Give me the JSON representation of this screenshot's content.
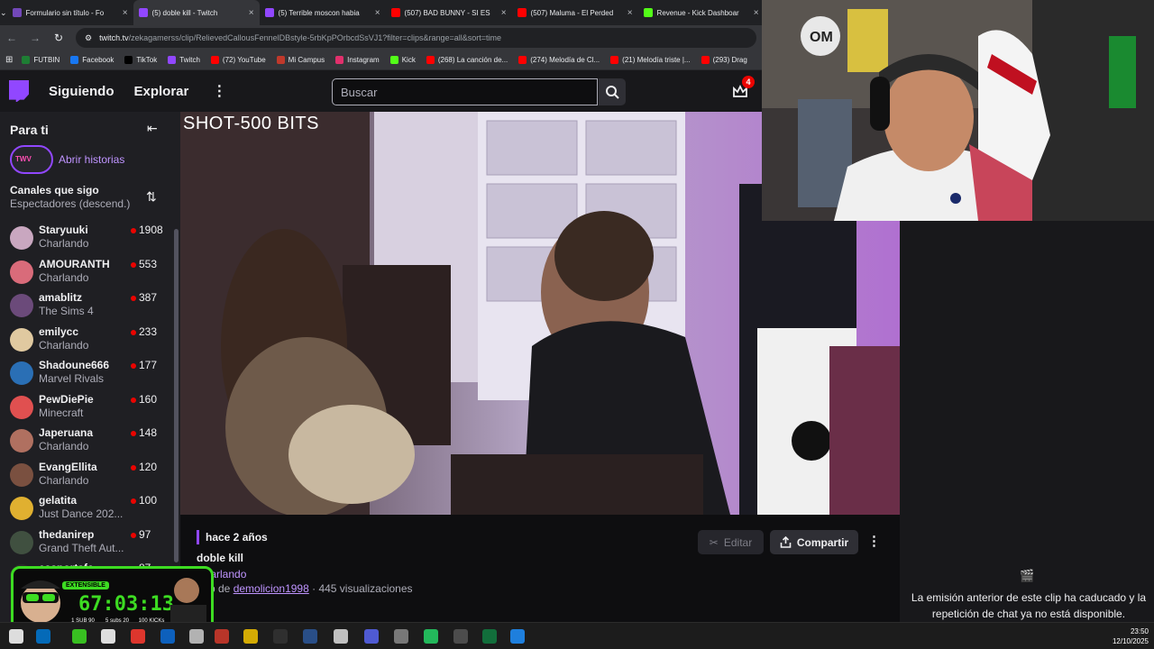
{
  "browser": {
    "tabs": [
      {
        "label": "Formulario sin título - Fo",
        "color": "#7248b9"
      },
      {
        "label": "(5) doble kill - Twitch",
        "color": "#9147ff",
        "active": true
      },
      {
        "label": "(5) Terrible moscon habia",
        "color": "#9147ff"
      },
      {
        "label": "(507) BAD BUNNY - SI ES",
        "color": "#ff0000"
      },
      {
        "label": "(507) Maluma - El Perded",
        "color": "#ff0000"
      },
      {
        "label": "Revenue - Kick Dashboar",
        "color": "#53fc18"
      }
    ],
    "url_host": "twitch.tv",
    "url_path": "/zekagamerss/clip/RelievedCallousFennelDBstyle-5rbKpPOrbcdSsVJ1?filter=clips&range=all&sort=time",
    "bookmarks": [
      {
        "label": "FUTBIN",
        "color": "#1e7e34"
      },
      {
        "label": "Facebook",
        "color": "#1877f2"
      },
      {
        "label": "TikTok",
        "color": "#000000"
      },
      {
        "label": "Twitch",
        "color": "#9147ff"
      },
      {
        "label": "(72) YouTube",
        "color": "#ff0000"
      },
      {
        "label": "Mi Campus",
        "color": "#c0392b"
      },
      {
        "label": "Instagram",
        "color": "#e1306c"
      },
      {
        "label": "Kick",
        "color": "#53fc18"
      },
      {
        "label": "(268) La canción de...",
        "color": "#ff0000"
      },
      {
        "label": "(274) Melodía de Cl...",
        "color": "#ff0000"
      },
      {
        "label": "(21) Melodía triste |...",
        "color": "#ff0000"
      },
      {
        "label": "(293) Drag",
        "color": "#ff0000"
      }
    ]
  },
  "nav": {
    "following": "Siguiendo",
    "explore": "Explorar",
    "search_placeholder": "Buscar",
    "notif_count": "4"
  },
  "sidebar": {
    "for_you": "Para ti",
    "open_stories": "Abrir historias",
    "followed_title": "Canales que sigo",
    "sort_label": "Espectadores (descend.)",
    "channels": [
      {
        "name": "Staryuuki",
        "game": "Charlando",
        "viewers": "1908",
        "color": "#c9a7c0"
      },
      {
        "name": "AMOURANTH",
        "game": "Charlando",
        "viewers": "553",
        "color": "#d96b7a"
      },
      {
        "name": "amablitz",
        "game": "The Sims 4",
        "viewers": "387",
        "color": "#6b4a7a"
      },
      {
        "name": "emilycc",
        "game": "Charlando",
        "viewers": "233",
        "color": "#e0c9a0"
      },
      {
        "name": "Shadoune666",
        "game": "Marvel Rivals",
        "viewers": "177",
        "color": "#2a6fb5"
      },
      {
        "name": "PewDiePie",
        "game": "Minecraft",
        "viewers": "160",
        "color": "#e05050"
      },
      {
        "name": "Japeruana",
        "game": "Charlando",
        "viewers": "148",
        "color": "#b07060"
      },
      {
        "name": "EvangEllita",
        "game": "Charlando",
        "viewers": "120",
        "color": "#7a5040"
      },
      {
        "name": "gelatita",
        "game": "Just Dance 202...",
        "viewers": "100",
        "color": "#e0b030"
      },
      {
        "name": "thedanirep",
        "game": "Grand Theft Aut...",
        "viewers": "97",
        "color": "#405040"
      },
      {
        "name": "easportsfc",
        "game": "",
        "viewers": "87",
        "color": "#2a2a2a"
      }
    ]
  },
  "video": {
    "overlay_text": "SHOT-500 BITS"
  },
  "clip": {
    "ago": "hace 2 años",
    "title": "doble kill",
    "category": "Charlando",
    "by_prefix": "Clip de",
    "author": "demolicion1998",
    "views": "· 445 visualizaciones",
    "edit_label": "Editar",
    "share_label": "Compartir"
  },
  "chat": {
    "message": "La emisión anterior de este clip ha caducado y la repetición de chat ya no está disponible."
  },
  "overlay": {
    "tag": "EXTENSIBLE",
    "timer": "67:03:13",
    "sub1": "1 SUB 90 MINUTES",
    "sub2": "5 subs 20 MIN",
    "sub3": "100 KICKs 15 MIN"
  },
  "taskbar": {
    "time": "23:50",
    "date": "12/10/2025"
  }
}
